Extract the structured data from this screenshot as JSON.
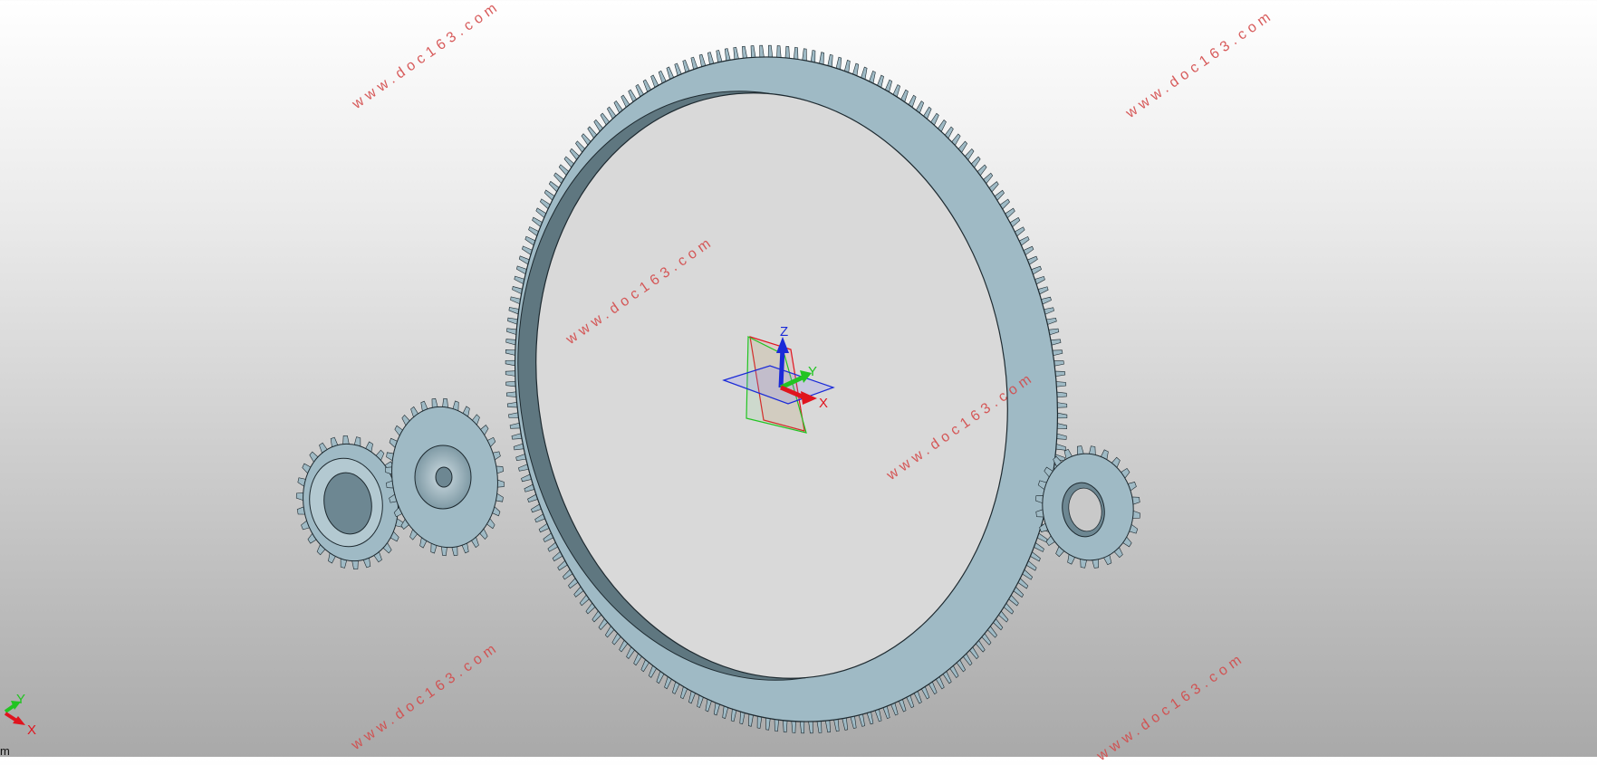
{
  "watermark": "www.doc163.com",
  "triad": {
    "z": "Z",
    "y": "Y",
    "x": "X"
  },
  "corner_triad": {
    "y": "Y",
    "x": "X"
  },
  "unit_label": "m",
  "colors": {
    "gear_face": "#9fbac5",
    "gear_shade": "#5f7780",
    "gear_edge": "#1e2a30",
    "axis_x": "#e0141e",
    "axis_y": "#22c422",
    "axis_z": "#1a2ad8",
    "watermark": "#d44a4a"
  }
}
